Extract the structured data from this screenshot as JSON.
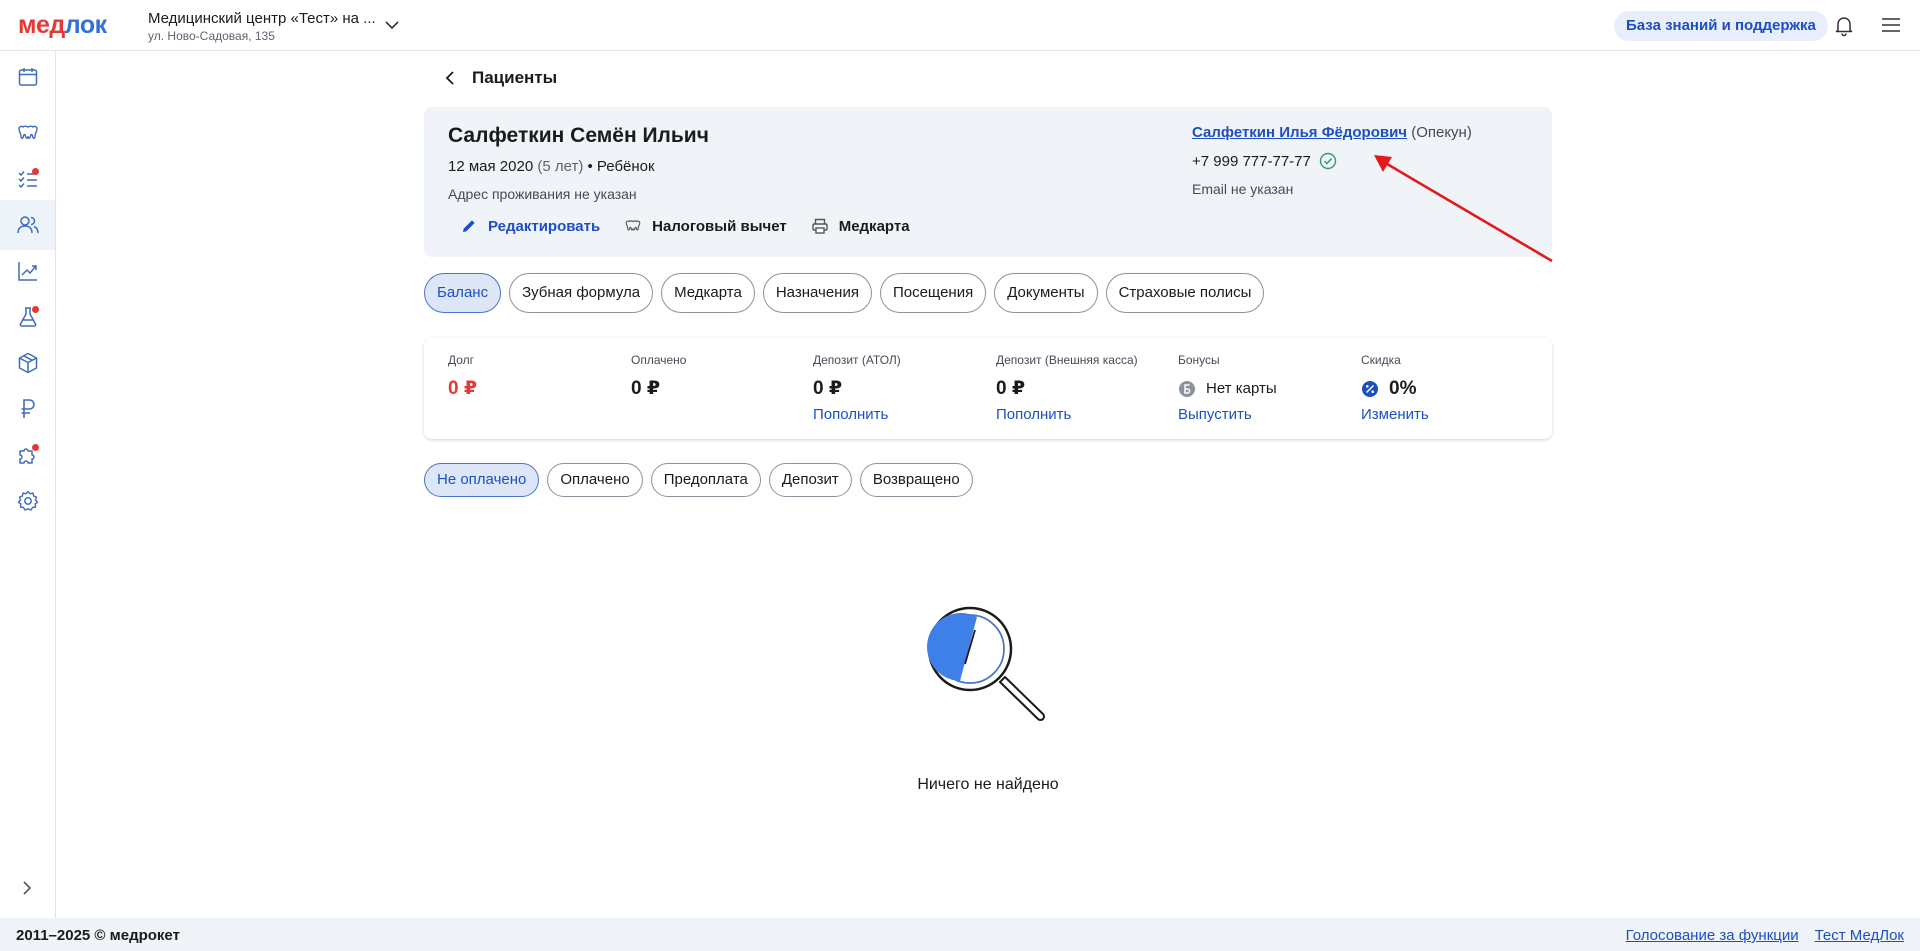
{
  "header": {
    "logo_part1": "мед",
    "logo_part2": "лок",
    "clinic_name": "Медицинский центр «Тест» на ...",
    "clinic_address": "ул. Ново-Садовая, 135",
    "kb_label": "База знаний и поддержка"
  },
  "sidebar": {
    "items": [
      {
        "icon": "calendar-icon",
        "badge": false,
        "active": false
      },
      {
        "icon": "teeth-icon",
        "badge": false,
        "active": false
      },
      {
        "icon": "checklist-icon",
        "badge": true,
        "active": false
      },
      {
        "icon": "users-icon",
        "badge": false,
        "active": true
      },
      {
        "icon": "chart-line-icon",
        "badge": false,
        "active": false
      },
      {
        "icon": "flask-icon",
        "badge": true,
        "active": false
      },
      {
        "icon": "box-icon",
        "badge": false,
        "active": false
      },
      {
        "icon": "ruble-icon",
        "badge": false,
        "active": false
      },
      {
        "icon": "puzzle-icon",
        "badge": true,
        "active": false
      },
      {
        "icon": "gear-icon",
        "badge": false,
        "active": false
      }
    ]
  },
  "breadcrumb": {
    "back_label": "Пациенты"
  },
  "patient": {
    "name": "Салфеткин Семён Ильич",
    "birth_date": "12 мая 2020",
    "age": "(5 лет)",
    "separator": "•",
    "category": "Ребёнок",
    "address": "Адрес проживания не указан",
    "actions": {
      "edit": "Редактировать",
      "tax": "Налоговый вычет",
      "medcard": "Медкарта"
    },
    "guardian_name": "Салфеткин Илья Фёдорович",
    "guardian_role": "(Опекун)",
    "phone": "+7 999 777-77-77",
    "email": "Email не указан"
  },
  "tabs": [
    "Баланс",
    "Зубная формула",
    "Медкарта",
    "Назначения",
    "Посещения",
    "Документы",
    "Страховые полисы"
  ],
  "active_tab": 0,
  "balance": {
    "debt_label": "Долг",
    "debt_value": "0 ₽",
    "paid_label": "Оплачено",
    "paid_value": "0 ₽",
    "deposit_atol_label": "Депозит (АТОЛ)",
    "deposit_atol_value": "0 ₽",
    "deposit_atol_link": "Пополнить",
    "deposit_ext_label": "Депозит (Внешняя касса)",
    "deposit_ext_value": "0 ₽",
    "deposit_ext_link": "Пополнить",
    "bonus_label": "Бонусы",
    "bonus_value": "Нет карты",
    "bonus_link": "Выпустить",
    "discount_label": "Скидка",
    "discount_value": "0%",
    "discount_link": "Изменить"
  },
  "filters": [
    "Не оплачено",
    "Оплачено",
    "Предоплата",
    "Депозит",
    "Возвращено"
  ],
  "active_filter": 0,
  "empty_state": "Ничего не найдено",
  "footer": {
    "copyright": "2011–2025 © медрокет",
    "links": [
      "Голосование за функции",
      "Тест МедЛок"
    ]
  },
  "colors": {
    "accent": "#1d4fc4",
    "danger": "#e53935",
    "success": "#2e9e6a",
    "card_bg": "#f0f3f8"
  }
}
